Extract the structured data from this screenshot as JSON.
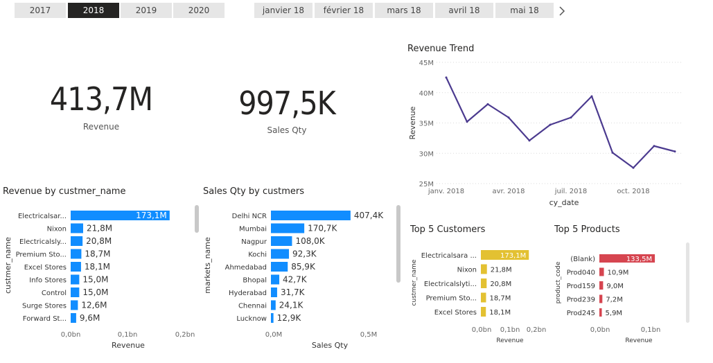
{
  "year_slicer": {
    "items": [
      "2017",
      "2018",
      "2019",
      "2020"
    ],
    "selected": "2018"
  },
  "month_slicer": {
    "items": [
      "janvier 18",
      "février 18",
      "mars 18",
      "avril 18",
      "mai 18"
    ],
    "next_icon": "chevron-right-icon"
  },
  "kpis": [
    {
      "value": "413,7M",
      "label": "Revenue"
    },
    {
      "value": "997,5K",
      "label": "Sales Qty"
    }
  ],
  "colors": {
    "blue": "#118dff",
    "line": "#4b3a8f",
    "yellow": "#e3c132",
    "red": "#d64550"
  },
  "chart_data": [
    {
      "type": "line",
      "title": "Revenue Trend",
      "xlabel": "cy_date",
      "ylabel": "Revenue",
      "x_ticks": [
        "janv. 2018",
        "avr. 2018",
        "juil. 2018",
        "oct. 2018"
      ],
      "y_ticks": [
        "25M",
        "30M",
        "35M",
        "40M",
        "45M"
      ],
      "ylim": [
        25,
        45
      ],
      "x": [
        "2018-01",
        "2018-02",
        "2018-03",
        "2018-04",
        "2018-05",
        "2018-06",
        "2018-07",
        "2018-08",
        "2018-09",
        "2018-10",
        "2018-11",
        "2018-12"
      ],
      "values": [
        42.5,
        35.2,
        38.1,
        35.9,
        32.1,
        34.7,
        35.9,
        39.4,
        30.1,
        27.6,
        31.2,
        30.3
      ]
    },
    {
      "type": "bar",
      "orientation": "horizontal",
      "title": "Revenue by custmer_name",
      "xlabel": "Revenue",
      "ylabel": "custmer_name",
      "x_ticks": [
        "0,0bn",
        "0,1bn",
        "0,2bn"
      ],
      "xlim": [
        0,
        0.2
      ],
      "categories": [
        "Electricalsar...",
        "Nixon",
        "Electricalsly...",
        "Premium Sto...",
        "Excel Stores",
        "Info Stores",
        "Control",
        "Surge Stores",
        "Forward St..."
      ],
      "values": [
        0.1731,
        0.0218,
        0.0208,
        0.0187,
        0.0181,
        0.015,
        0.015,
        0.0126,
        0.0096
      ],
      "labels": [
        "173,1M",
        "21,8M",
        "20,8M",
        "18,7M",
        "18,1M",
        "15,0M",
        "15,0M",
        "12,6M",
        "9,6M"
      ]
    },
    {
      "type": "bar",
      "orientation": "horizontal",
      "title": "Sales Qty by custmers",
      "xlabel": "Sales Qty",
      "ylabel": "markets_name",
      "x_ticks": [
        "0,0M",
        "0,5M"
      ],
      "xlim": [
        0,
        0.5
      ],
      "categories": [
        "Delhi NCR",
        "Mumbai",
        "Nagpur",
        "Kochi",
        "Ahmedabad",
        "Bhopal",
        "Hyderabad",
        "Chennai",
        "Lucknow"
      ],
      "values": [
        0.4074,
        0.1707,
        0.108,
        0.0923,
        0.0859,
        0.0427,
        0.0317,
        0.0241,
        0.0129
      ],
      "labels": [
        "407,4K",
        "170,7K",
        "108,0K",
        "92,3K",
        "85,9K",
        "42,7K",
        "31,7K",
        "24,1K",
        "12,9K"
      ]
    },
    {
      "type": "bar",
      "orientation": "horizontal",
      "title": "Top 5 Customers",
      "xlabel": "Revenue",
      "ylabel": "custmer_name",
      "x_ticks": [
        "0,0bn",
        "0,1bn",
        "0,2bn"
      ],
      "xlim": [
        0,
        0.2
      ],
      "categories": [
        "Electricalsara ...",
        "Nixon",
        "Electricalslyti...",
        "Premium Sto...",
        "Excel Stores"
      ],
      "values": [
        0.1731,
        0.0218,
        0.0208,
        0.0187,
        0.0181
      ],
      "labels": [
        "173,1M",
        "21,8M",
        "20,8M",
        "18,7M",
        "18,1M"
      ]
    },
    {
      "type": "bar",
      "orientation": "horizontal",
      "title": "Top 5 Products",
      "xlabel": "Revenue",
      "ylabel": "product_code",
      "x_ticks": [
        "0,0bn",
        "0,1bn"
      ],
      "xlim": [
        0,
        0.1667
      ],
      "categories": [
        "(Blank)",
        "Prod040",
        "Prod159",
        "Prod239",
        "Prod245"
      ],
      "values": [
        0.1335,
        0.0109,
        0.009,
        0.0072,
        0.0059
      ],
      "labels": [
        "133,5M",
        "10,9M",
        "9,0M",
        "7,2M",
        "5,9M"
      ]
    }
  ]
}
